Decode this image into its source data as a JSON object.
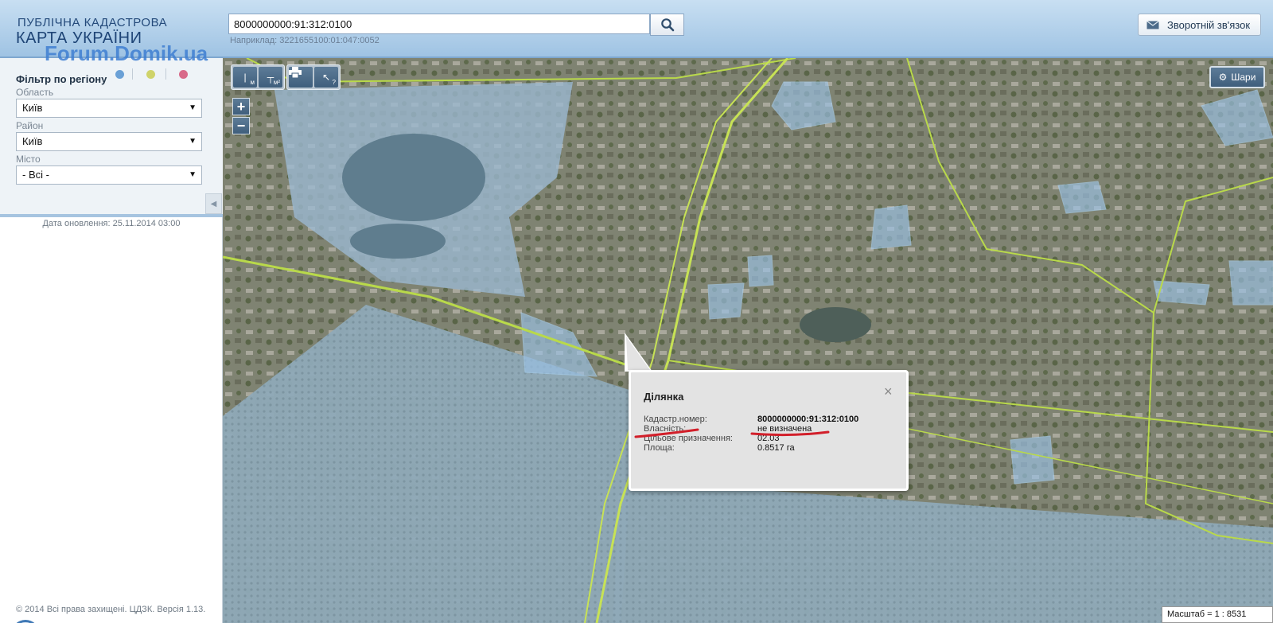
{
  "header": {
    "logo_line1": "ПУБЛІЧНА КАДАСТРОВА",
    "logo_line2": "КАРТА УКРАЇНИ",
    "watermark": "Forum.Domik.ua",
    "search_value": "8000000000:91:312:0100",
    "search_hint": "Наприклад: 3221655100:01:047:0052",
    "feedback_label": "Зворотній зв'язок"
  },
  "sidebar": {
    "filter_title": "Фільтр по регіону",
    "dot_colors": [
      "#6aa0d6",
      "#cfd36a",
      "#d86a8a"
    ],
    "fields": [
      {
        "label": "Область",
        "value": "Київ"
      },
      {
        "label": "Район",
        "value": "Київ"
      },
      {
        "label": "Місто",
        "value": "- Всі -"
      }
    ],
    "update_date": "Дата оновлення: 25.11.2014 03:00",
    "copyright": "© 2014 Всі права захищені. ЦДЗК. Версія 1.13."
  },
  "map": {
    "tools": {
      "measure_length_unit": "м",
      "measure_area_unit": "м²",
      "info_hint": "?"
    },
    "zoom_in": "+",
    "zoom_out": "−",
    "layers_label": "Шари",
    "scale": "Масштаб = 1 : 8531"
  },
  "popup": {
    "title": "Ділянка",
    "close": "×",
    "rows": [
      {
        "label": "Кадастр.номер:",
        "value": "8000000000:91:312:0100"
      },
      {
        "label": "Власність:",
        "value": "не визначена"
      },
      {
        "label": "Цільове призначення:",
        "value": "02.03"
      },
      {
        "label": "Площа:",
        "value": "0.8517 га"
      }
    ]
  }
}
